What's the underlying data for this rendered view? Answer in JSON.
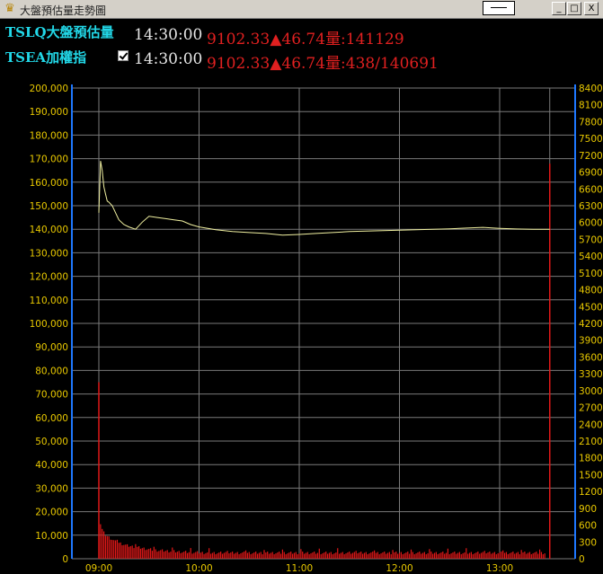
{
  "window": {
    "title": "大盤預估量走勢圖",
    "icon": "crown-icon",
    "buttons": {
      "minimize": "_",
      "maximize": "□",
      "close": "X"
    }
  },
  "rows": [
    {
      "label": "TSLQ大盤預估量",
      "time": "14:30:00",
      "index": "9102.33",
      "arrow": "▲",
      "change": "46.74",
      "volume_text": "量:141129",
      "has_checkbox": false
    },
    {
      "label": "TSEA加權指",
      "time": "14:30:00",
      "index": "9102.33",
      "arrow": "▲",
      "change": "46.74",
      "volume_text": "量:438/140691",
      "has_checkbox": true,
      "checked": true
    }
  ],
  "colors": {
    "label": "#22d8e8",
    "time": "#e6e6e6",
    "value": "#e02020",
    "line": "#f0f0a0",
    "bars": "#e01818",
    "axis": "#1e78ff",
    "grid": "#7a7a7a",
    "tick": "#e8c800"
  },
  "chart_data": {
    "type": "line",
    "x_ticks": [
      "09:00",
      "10:00",
      "11:00",
      "12:00",
      "13:00"
    ],
    "x_domain_minutes": [
      0,
      270
    ],
    "left_axis": {
      "min": 0,
      "max": 200000,
      "step": 10000,
      "ticks": [
        "0",
        "10,000",
        "20,000",
        "30,000",
        "40,000",
        "50,000",
        "60,000",
        "70,000",
        "80,000",
        "90,000",
        "100,000",
        "110,000",
        "120,000",
        "130,000",
        "140,000",
        "150,000",
        "160,000",
        "170,000",
        "180,000",
        "190,000",
        "200,000"
      ]
    },
    "right_axis": {
      "min": 0,
      "max": 8400,
      "step": 300,
      "ticks": [
        "0",
        "300",
        "600",
        "900",
        "1200",
        "1500",
        "1800",
        "2100",
        "2400",
        "2700",
        "3000",
        "3300",
        "3600",
        "3900",
        "4200",
        "4500",
        "4800",
        "5100",
        "5400",
        "5700",
        "6000",
        "6300",
        "6600",
        "6900",
        "7200",
        "7500",
        "7800",
        "8100",
        "8400"
      ]
    },
    "grid": true,
    "series": [
      {
        "kind": "line",
        "axis": "left",
        "x": [
          0,
          1,
          2,
          3,
          4,
          5,
          6,
          8,
          10,
          12,
          15,
          18,
          22,
          26,
          30,
          35,
          40,
          45,
          50,
          55,
          60,
          70,
          80,
          90,
          100,
          110,
          120,
          130,
          140,
          150,
          160,
          170,
          180,
          190,
          200,
          210,
          220,
          230,
          240,
          250,
          260,
          270
        ],
        "y": [
          147000,
          169000,
          165000,
          158000,
          155000,
          152000,
          151500,
          150000,
          147000,
          144000,
          142000,
          141000,
          140000,
          143000,
          145500,
          145000,
          144500,
          144000,
          143500,
          142000,
          141000,
          139800,
          139000,
          138600,
          138200,
          137500,
          137800,
          138200,
          138600,
          139000,
          139200,
          139400,
          139600,
          139800,
          140000,
          140200,
          140500,
          140800,
          140400,
          140100,
          140000,
          140000
        ]
      },
      {
        "kind": "bars",
        "axis": "right",
        "opening_bar": 3150,
        "closing_bar": 7050,
        "opening_minute": 0,
        "closing_minute": 270,
        "values": [
          700,
          620,
          520,
          460,
          420,
          400,
          380,
          360,
          340,
          320,
          300,
          290,
          280,
          270,
          260,
          250,
          240,
          230,
          225,
          220,
          215,
          210,
          205,
          200,
          195,
          190,
          185,
          180,
          175,
          170,
          165,
          160,
          155,
          150,
          148,
          146,
          144,
          142,
          140,
          138,
          136,
          134,
          132,
          130,
          128,
          126,
          124,
          122,
          120,
          118,
          116,
          115,
          114,
          113,
          112,
          111,
          110,
          109,
          108,
          107,
          106,
          105,
          104,
          103,
          102,
          101,
          100,
          100,
          100,
          100
        ]
      }
    ]
  }
}
